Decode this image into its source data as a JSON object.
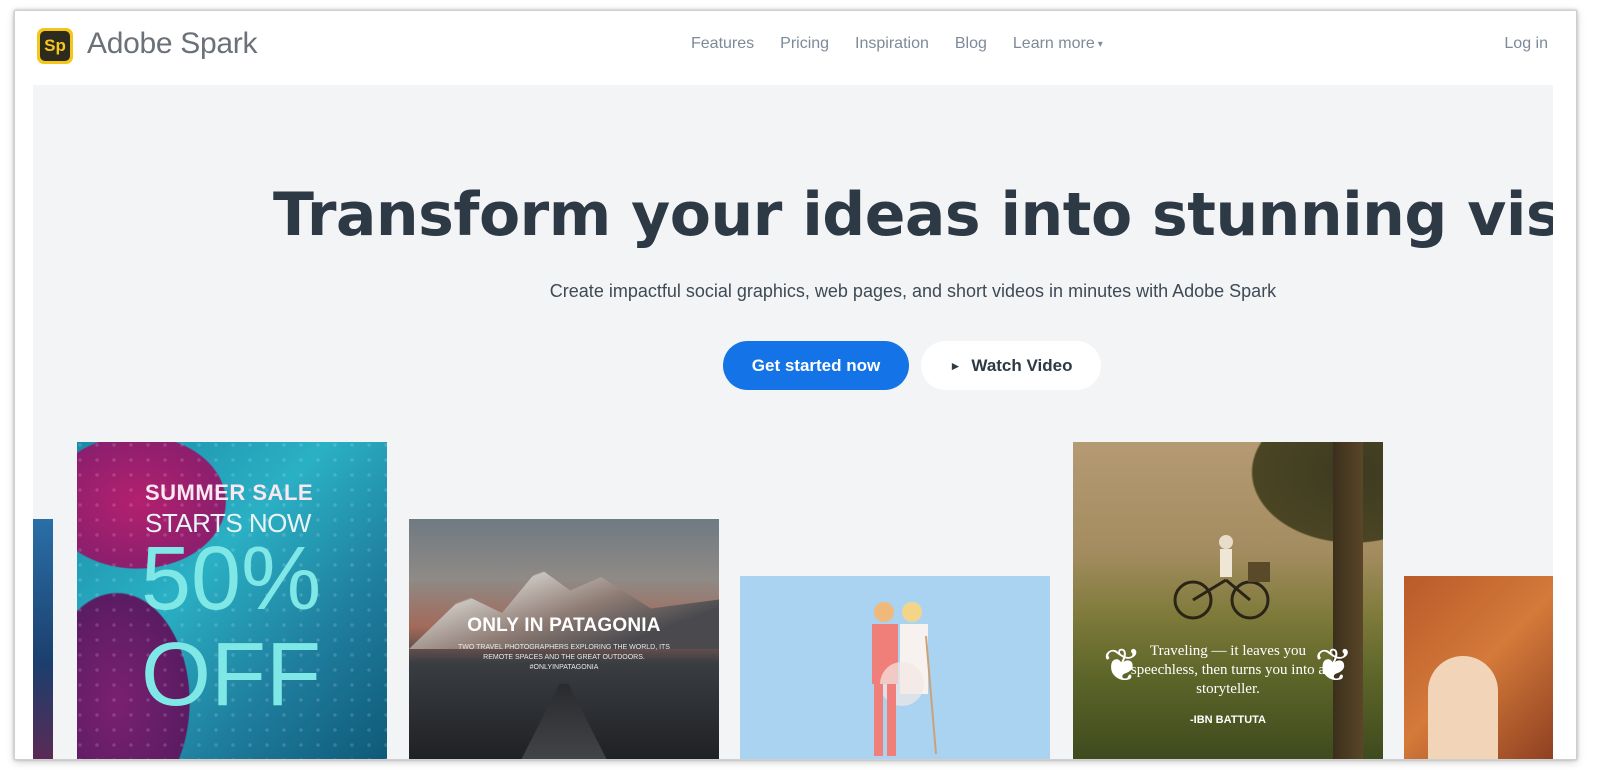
{
  "brand": {
    "badge": "Sp",
    "name": "Adobe Spark"
  },
  "nav": {
    "items": [
      "Features",
      "Pricing",
      "Inspiration",
      "Blog",
      "Learn more"
    ],
    "login": "Log in"
  },
  "hero": {
    "headline": "Transform your ideas into stunning visual stories",
    "subline": "Create impactful social graphics, web pages, and short videos in minutes with Adobe Spark",
    "cta_label": "Get started now",
    "watch_label": "Watch Video"
  },
  "cards": {
    "summer": {
      "line1": "SUMMER SALE",
      "line2": "STARTS NOW",
      "line3": "50%",
      "line4": "OFF"
    },
    "patagonia": {
      "title": "ONLY IN PATAGONIA",
      "subtitle": "TWO TRAVEL PHOTOGRAPHERS EXPLORING THE WORLD, ITS REMOTE SPACES AND THE GREAT OUTDOORS. #ONLYINPATAGONIA"
    },
    "quote": {
      "text": "Traveling — it leaves you speechless, then turns you into a storyteller.",
      "author": "-IBN BATTUTA"
    }
  },
  "colors": {
    "accent": "#1473e6",
    "headline": "#2d3944",
    "nav": "#7c8a9a",
    "hero_bg": "#f3f4f6"
  },
  "icons": {
    "play": "play-icon",
    "caret": "chevron-down-icon"
  }
}
